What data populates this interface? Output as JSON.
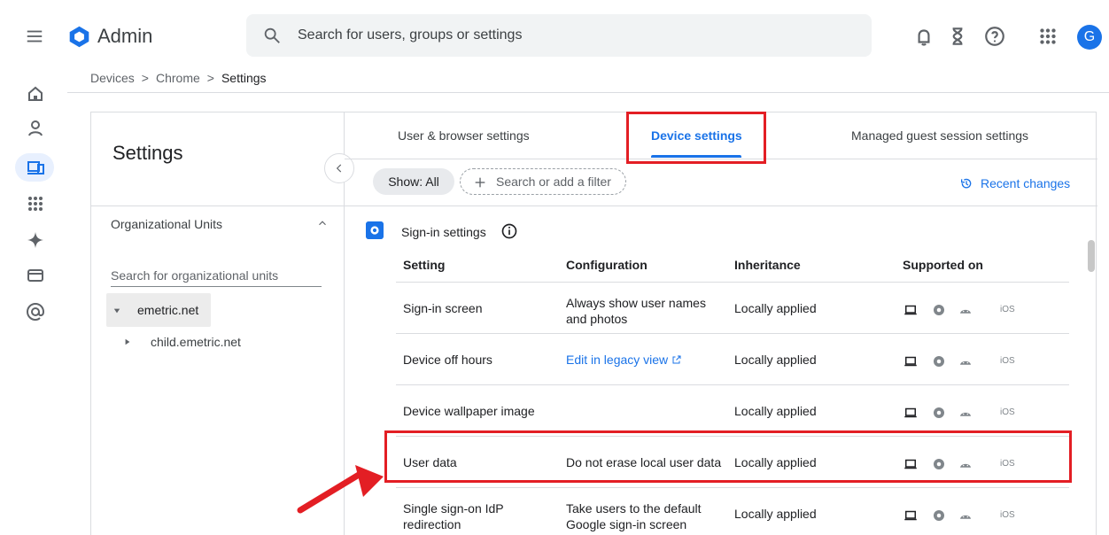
{
  "app": {
    "name": "Admin",
    "search_placeholder": "Search for users, groups or settings",
    "avatar_letter": "G"
  },
  "breadcrumb": [
    "Devices",
    ">",
    "Chrome",
    ">",
    "Settings"
  ],
  "left_panel": {
    "title": "Settings",
    "ou_title": "Organizational Units",
    "ou_search_placeholder": "Search for organizational units",
    "root_ou": "emetric.net",
    "child_ou": "child.emetric.net"
  },
  "tabs": [
    "User & browser settings",
    "Device settings",
    "Managed guest session settings"
  ],
  "filters": {
    "show": "Show: All",
    "search": "Search or add a filter",
    "recent": "Recent changes"
  },
  "section": {
    "title": "Sign-in settings",
    "columns": [
      "Setting",
      "Configuration",
      "Inheritance",
      "Supported on"
    ],
    "rows": [
      {
        "setting": "Sign-in screen",
        "configuration": "Always show user names and photos",
        "inheritance": "Locally applied",
        "supported": "iOS"
      },
      {
        "setting": "Device off hours",
        "configuration": "Edit in legacy view",
        "inheritance": "Locally applied",
        "supported": "iOS"
      },
      {
        "setting": "Device wallpaper image",
        "configuration": "",
        "inheritance": "Locally applied",
        "supported": "iOS"
      },
      {
        "setting": "User data",
        "configuration": "Do not erase local user data",
        "inheritance": "Locally applied",
        "supported": "iOS"
      },
      {
        "setting": "Single sign-on IdP redirection",
        "configuration": "Take users to the default Google sign-in screen",
        "inheritance": "Locally applied",
        "supported": "iOS"
      }
    ]
  },
  "colors": {
    "accent": "#1a73e8",
    "highlight": "#e31e24",
    "muted": "#80868b"
  },
  "icons": [
    "menu-icon",
    "admin-logo-icon",
    "search-icon",
    "notification-icon",
    "hourglass-icon",
    "help-icon",
    "apps-icon",
    "home-icon",
    "user-icon",
    "devices-icon",
    "apps-grid-icon",
    "sparkle-icon",
    "billing-icon",
    "at-sign-icon",
    "collapse-chevron-icon",
    "info-icon",
    "laptop-icon",
    "chrome-icon",
    "android-icon",
    "external-link-icon"
  ]
}
